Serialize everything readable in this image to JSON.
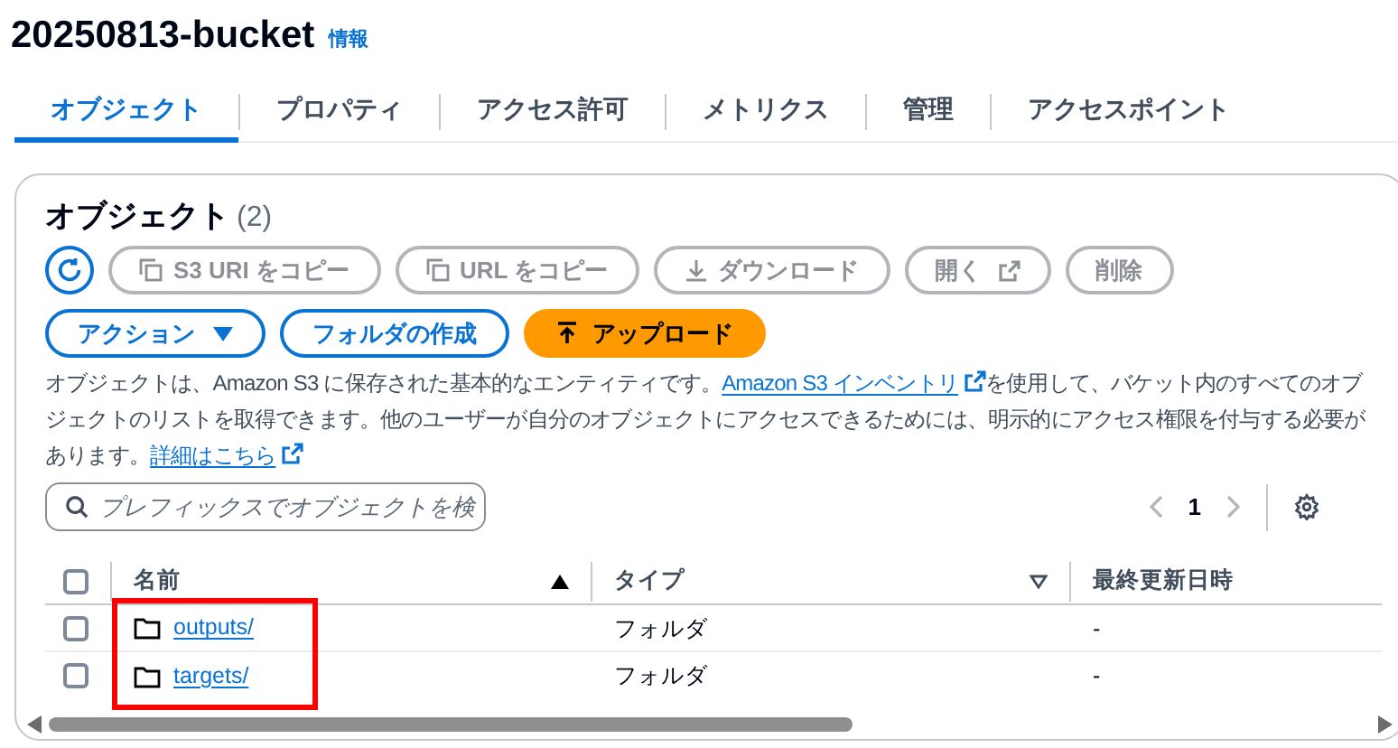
{
  "header": {
    "title": "20250813-bucket",
    "info_link": "情報"
  },
  "tabs": [
    {
      "label": "オブジェクト",
      "selected": true
    },
    {
      "label": "プロパティ",
      "selected": false
    },
    {
      "label": "アクセス許可",
      "selected": false
    },
    {
      "label": "メトリクス",
      "selected": false
    },
    {
      "label": "管理",
      "selected": false
    },
    {
      "label": "アクセスポイント",
      "selected": false
    }
  ],
  "objects_panel": {
    "title": "オブジェクト",
    "count": "(2)",
    "toolbar": [
      {
        "kind": "refresh",
        "disabled": false
      },
      {
        "kind": "copy",
        "label": "S3 URI をコピー",
        "disabled": true
      },
      {
        "kind": "copy",
        "label": "URL をコピー",
        "disabled": true
      },
      {
        "kind": "download",
        "label": "ダウンロード",
        "disabled": true
      },
      {
        "kind": "open",
        "label": "開く",
        "disabled": true
      },
      {
        "kind": "plain",
        "label": "削除",
        "disabled": true
      }
    ],
    "actions": [
      {
        "kind": "dropdown",
        "label": "アクション"
      },
      {
        "kind": "outline",
        "label": "フォルダの作成"
      },
      {
        "kind": "upload",
        "label": "アップロード"
      }
    ],
    "description": [
      {
        "kind": "text",
        "text": "オブジェクトは、Amazon S3 に保存された基本的なエンティティです。"
      },
      {
        "kind": "link",
        "text": "Amazon S3 インベントリ"
      },
      {
        "kind": "text",
        "text": "を使用して、バケット内のすべてのオブジェクトのリストを取得できます。他のユーザーが自分のオブジェクトにアクセスできるためには、明示的にアクセス権限を付与する必要があります。"
      },
      {
        "kind": "link",
        "text": "詳細はこちら"
      }
    ],
    "search": {
      "placeholder": "プレフィックスでオブジェクトを検"
    },
    "pagination": {
      "page": "1"
    },
    "table": {
      "all_checked": false,
      "columns": [
        {
          "label": "名前",
          "sorted": true
        },
        {
          "label": "タイプ",
          "sorted": false
        },
        {
          "label": "最終更新日時"
        }
      ],
      "rows": [
        {
          "name": "outputs/",
          "type": "フォルダ",
          "modified": "-",
          "checked": false
        },
        {
          "name": "targets/",
          "type": "フォルダ",
          "modified": "-",
          "checked": false
        }
      ]
    }
  }
}
